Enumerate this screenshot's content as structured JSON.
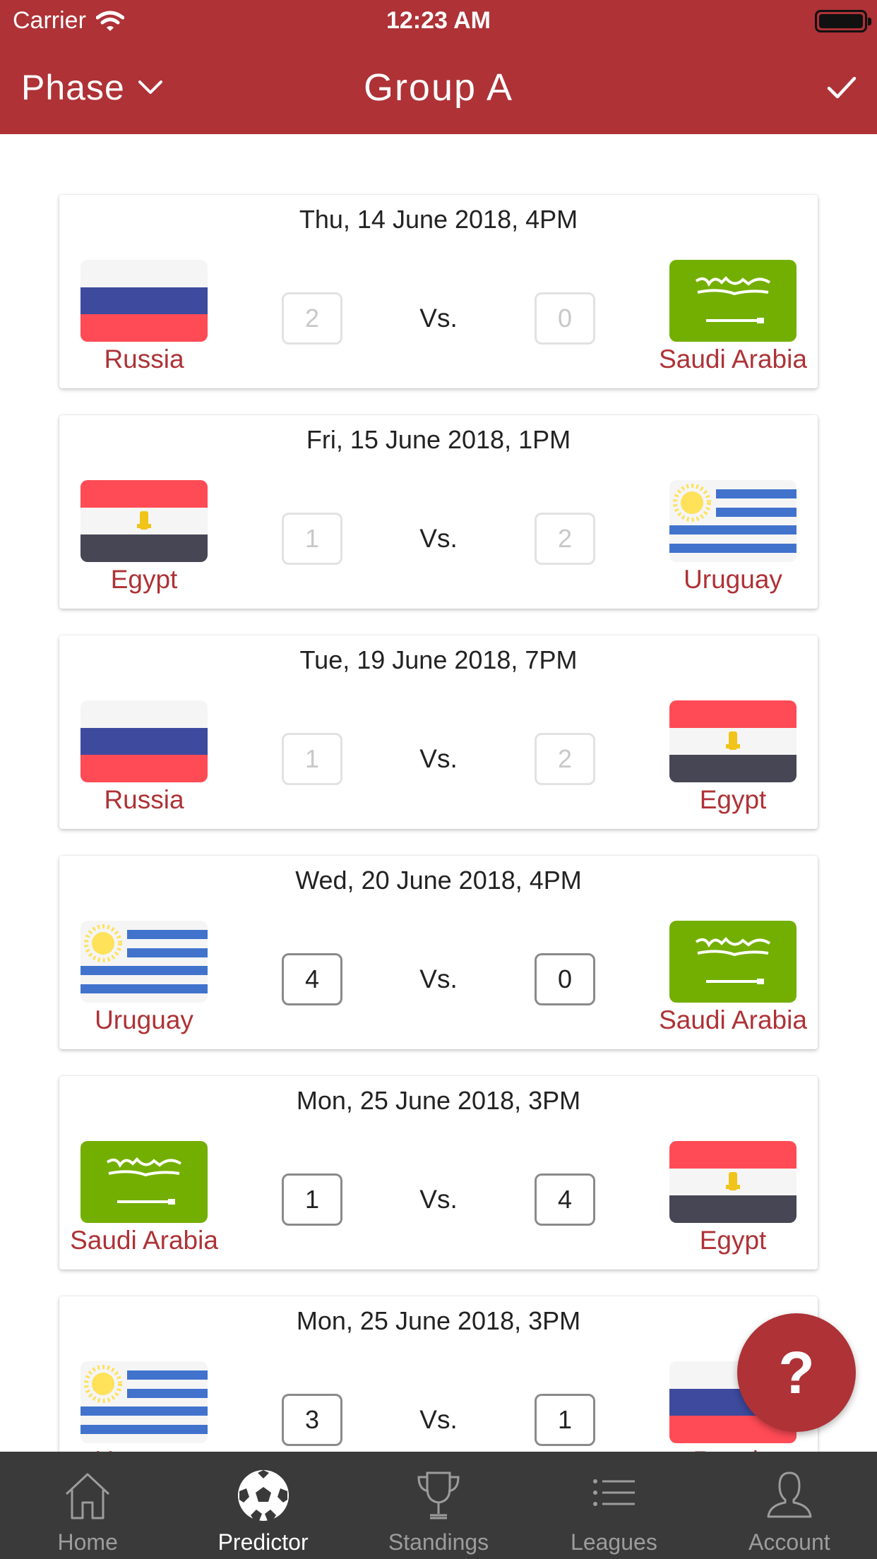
{
  "status_bar": {
    "carrier": "Carrier",
    "time": "12:23 AM"
  },
  "nav": {
    "phase_label": "Phase",
    "title": "Group A",
    "confirm_icon": "check-icon"
  },
  "colors": {
    "brand": "#ae3236",
    "tab_bar": "#3a3a3a",
    "tab_inactive": "#9c9c9c",
    "tab_active": "#ffffff"
  },
  "matches": [
    {
      "date": "Thu, 14 June 2018, 4PM",
      "home": "Russia",
      "home_flag": "russia",
      "home_score": "2",
      "vs": "Vs.",
      "away": "Saudi Arabia",
      "away_flag": "saudi",
      "away_score": "0",
      "locked": true
    },
    {
      "date": "Fri, 15 June 2018, 1PM",
      "home": "Egypt",
      "home_flag": "egypt",
      "home_score": "1",
      "vs": "Vs.",
      "away": "Uruguay",
      "away_flag": "uruguay",
      "away_score": "2",
      "locked": true
    },
    {
      "date": "Tue, 19 June 2018, 7PM",
      "home": "Russia",
      "home_flag": "russia",
      "home_score": "1",
      "vs": "Vs.",
      "away": "Egypt",
      "away_flag": "egypt",
      "away_score": "2",
      "locked": true
    },
    {
      "date": "Wed, 20 June 2018, 4PM",
      "home": "Uruguay",
      "home_flag": "uruguay",
      "home_score": "4",
      "vs": "Vs.",
      "away": "Saudi Arabia",
      "away_flag": "saudi",
      "away_score": "0",
      "locked": false
    },
    {
      "date": "Mon, 25 June 2018, 3PM",
      "home": "Saudi Arabia",
      "home_flag": "saudi",
      "home_score": "1",
      "vs": "Vs.",
      "away": "Egypt",
      "away_flag": "egypt",
      "away_score": "4",
      "locked": false
    },
    {
      "date": "Mon, 25 June 2018, 3PM",
      "home": "Uruguay",
      "home_flag": "uruguay",
      "home_score": "3",
      "vs": "Vs.",
      "away": "Russia",
      "away_flag": "russia",
      "away_score": "1",
      "locked": false
    }
  ],
  "fab": {
    "label": "?",
    "icon": "help-icon"
  },
  "tabs": [
    {
      "label": "Home",
      "icon": "home-icon",
      "active": false
    },
    {
      "label": "Predictor",
      "icon": "soccer-ball-icon",
      "active": true
    },
    {
      "label": "Standings",
      "icon": "trophy-icon",
      "active": false
    },
    {
      "label": "Leagues",
      "icon": "list-icon",
      "active": false
    },
    {
      "label": "Account",
      "icon": "user-icon",
      "active": false
    }
  ]
}
